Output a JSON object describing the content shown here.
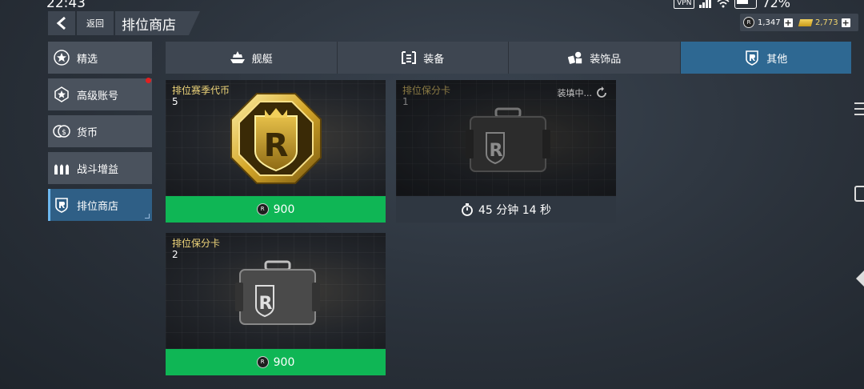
{
  "status_bar": {
    "time": "22:43",
    "vpn": "VPN",
    "battery": "72%"
  },
  "header": {
    "back_label": "返回",
    "title": "排位商店"
  },
  "currencies": [
    {
      "icon": "rank-coin-icon",
      "value": "1,347",
      "plus": "+"
    },
    {
      "icon": "gold-bar-icon",
      "value": "2,773",
      "plus": "+"
    }
  ],
  "sidebar": {
    "items": [
      {
        "label": "精选",
        "icon": "star-badge-icon"
      },
      {
        "label": "高级账号",
        "icon": "premium-star-icon",
        "badge": true
      },
      {
        "label": "货币",
        "icon": "coins-icon"
      },
      {
        "label": "战斗增益",
        "icon": "ammo-icon"
      },
      {
        "label": "排位商店",
        "icon": "rank-shield-icon",
        "active": true
      }
    ]
  },
  "tabs": [
    {
      "label": "舰艇",
      "icon": "ship-icon"
    },
    {
      "label": "装备",
      "icon": "equipment-icon"
    },
    {
      "label": "装饰品",
      "icon": "decor-icon"
    },
    {
      "label": "其他",
      "icon": "rank-shield-icon",
      "active": true
    }
  ],
  "cards": [
    {
      "name": "排位赛季代币",
      "count": "5",
      "price": "900",
      "footer": "price"
    },
    {
      "name": "排位保分卡",
      "count": "1",
      "status": "装填中...",
      "timer": "45 分钟 14 秒",
      "footer": "timer"
    },
    {
      "name": "排位保分卡",
      "count": "2",
      "price": "900",
      "footer": "price"
    }
  ],
  "glyphs": {
    "coin_letter": "R",
    "emblem_letter": "R"
  },
  "colors": {
    "accent_green": "#0fb655",
    "active_tab": "#2e6892",
    "gold_text": "#f0d67a"
  }
}
